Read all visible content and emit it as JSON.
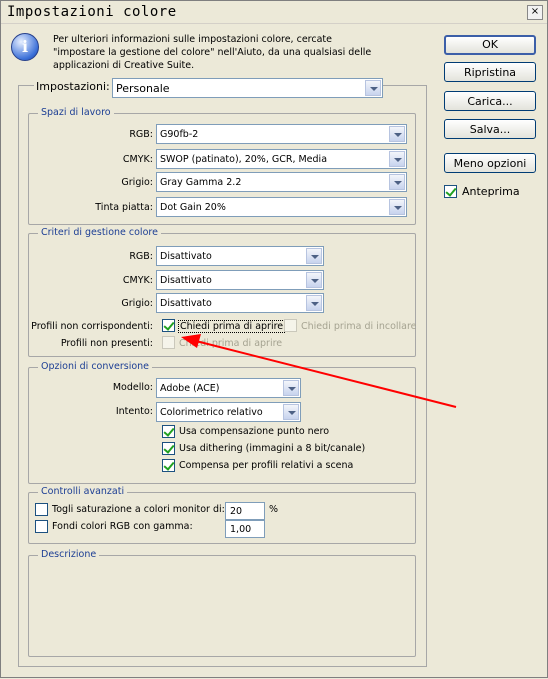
{
  "window": {
    "title": "Impostazioni colore",
    "close_label": "×"
  },
  "info": {
    "icon": "info-icon",
    "icon_glyph": "i",
    "text": "Per ulteriori informazioni sulle impostazioni colore, cercate \"impostare la gestione del colore\" nell'Aiuto, da una qualsiasi delle applicazioni di Creative Suite."
  },
  "buttons": {
    "ok": "OK",
    "reset": "Ripristina",
    "load": "Carica...",
    "save": "Salva...",
    "fewer_options": "Meno opzioni"
  },
  "preview": {
    "label": "Anteprima",
    "checked": true
  },
  "settings": {
    "label": "Impostazioni:",
    "value": "Personale"
  },
  "working_spaces": {
    "title": "Spazi di lavoro",
    "rgb": {
      "label": "RGB:",
      "value": "G90fb-2"
    },
    "cmyk": {
      "label": "CMYK:",
      "value": "SWOP (patinato), 20%, GCR, Media"
    },
    "gray": {
      "label": "Grigio:",
      "value": "Gray Gamma 2.2"
    },
    "spot": {
      "label": "Tinta piatta:",
      "value": "Dot Gain 20%"
    }
  },
  "policies": {
    "title": "Criteri di gestione colore",
    "rgb": {
      "label": "RGB:",
      "value": "Disattivato"
    },
    "cmyk": {
      "label": "CMYK:",
      "value": "Disattivato"
    },
    "gray": {
      "label": "Grigio:",
      "value": "Disattivato"
    },
    "mismatch_label": "Profili non corrispondenti:",
    "mismatch_open": "Chiedi prima di aprire",
    "mismatch_paste": "Chiedi prima di incollare",
    "missing_label": "Profili non presenti:",
    "missing_open": "Chiedi prima di aprire"
  },
  "conversion": {
    "title": "Opzioni di conversione",
    "engine": {
      "label": "Modello:",
      "value": "Adobe (ACE)"
    },
    "intent": {
      "label": "Intento:",
      "value": "Colorimetrico relativo"
    },
    "black_point": "Usa compensazione punto nero",
    "dither": "Usa dithering (immagini a 8 bit/canale)",
    "scene": "Compensa per profili relativi a scena"
  },
  "advanced": {
    "title": "Controlli avanzati",
    "desaturate_label": "Togli saturazione a colori monitor di:",
    "desaturate_value": "20",
    "desaturate_unit": "%",
    "blend_label": "Fondi colori RGB con gamma:",
    "blend_value": "1,00"
  },
  "description": {
    "title": "Descrizione"
  },
  "annotation": {
    "arrow_color": "#FF0000"
  }
}
